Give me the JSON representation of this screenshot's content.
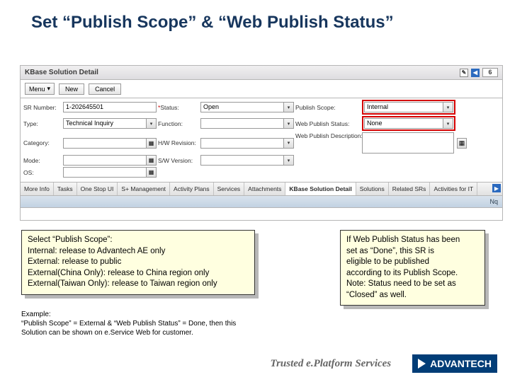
{
  "title": "Set “Publish Scope” & “Web Publish Status”",
  "panel": {
    "title": "KBase Solution Detail",
    "page_count": "6",
    "menu_label": "Menu",
    "new_label": "New",
    "cancel_label": "Cancel"
  },
  "form": {
    "sr_number_label": "SR Number:",
    "sr_number_value": "1-202645501",
    "status_label": "Status:",
    "status_value": "Open",
    "publish_scope_label": "Publish Scope:",
    "publish_scope_value": "Internal",
    "type_label": "Type:",
    "type_value": "Technical Inquiry",
    "function_label": "Function:",
    "web_publish_status_label": "Web Publish Status:",
    "web_publish_status_value": "None",
    "category_label": "Category:",
    "hw_revision_label": "H/W Revision:",
    "web_publish_desc_label": "Web Publish Description:",
    "mode_label": "Mode:",
    "sw_version_label": "S/W Version:",
    "os_label": "OS:"
  },
  "tabs": {
    "items": [
      "More Info",
      "Tasks",
      "One Stop UI",
      "S+ Management",
      "Activity Plans",
      "Services",
      "Attachments",
      "KBase Solution Detail",
      "Solutions",
      "Related SRs",
      "Activities for IT"
    ],
    "active_index": 7
  },
  "subpanel": {
    "nq_label": "Nq"
  },
  "note_left": {
    "l1": "Select “Publish Scope”:",
    "l2": "Internal: release to Advantech AE only",
    "l3": "External: release to public",
    "l4": "External(China Only): release to China region only",
    "l5": "External(Taiwan Only): release to Taiwan region only"
  },
  "note_right": {
    "l1": "If Web Publish Status has been",
    "l2": "set as “Done”, this SR is",
    "l3": "eligible to be published",
    "l4": "according to its Publish Scope.",
    "l5": "Note: Status need to be set as",
    "l6": "“Closed” as well."
  },
  "example": {
    "l1": "Example:",
    "l2": "“Publish Scope” = External & “Web Publish Status” = Done, then this",
    "l3": "Solution can be shown on e.Service Web for customer."
  },
  "footer": {
    "slogan": "Trusted e.Platform Services",
    "brand": "ADVANTECH"
  }
}
